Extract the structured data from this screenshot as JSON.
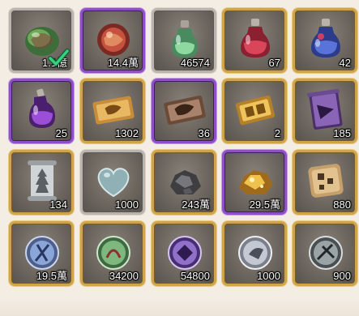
{
  "inventory": {
    "items": [
      {
        "name": "green-orb",
        "qty": "1.1億",
        "frame": "silver",
        "selected": true
      },
      {
        "name": "red-orb",
        "qty": "14.4萬",
        "frame": "purple"
      },
      {
        "name": "green-potion",
        "qty": "46574",
        "frame": "silver"
      },
      {
        "name": "red-potion",
        "qty": "67",
        "frame": "gold"
      },
      {
        "name": "blue-potion",
        "qty": "42",
        "frame": "gold"
      },
      {
        "name": "purple-potion",
        "qty": "25",
        "frame": "purple"
      },
      {
        "name": "gold-ticket",
        "qty": "1302",
        "frame": "gold"
      },
      {
        "name": "bronze-ticket",
        "qty": "36",
        "frame": "purple"
      },
      {
        "name": "gold-coupon",
        "qty": "2",
        "frame": "gold"
      },
      {
        "name": "purple-scroll",
        "qty": "185",
        "frame": "gold"
      },
      {
        "name": "silver-scroll",
        "qty": "134",
        "frame": "gold"
      },
      {
        "name": "silver-heart",
        "qty": "1000",
        "frame": "silver"
      },
      {
        "name": "iron-ore",
        "qty": "243萬",
        "frame": "gold"
      },
      {
        "name": "gold-ore",
        "qty": "29.5萬",
        "frame": "purple"
      },
      {
        "name": "gold-cookie",
        "qty": "880",
        "frame": "gold"
      },
      {
        "name": "blue-medal",
        "qty": "19.5萬",
        "frame": "gold"
      },
      {
        "name": "green-medal",
        "qty": "34200",
        "frame": "gold"
      },
      {
        "name": "purple-medal",
        "qty": "54800",
        "frame": "gold"
      },
      {
        "name": "silver-medal",
        "qty": "1000",
        "frame": "gold"
      },
      {
        "name": "dark-medal",
        "qty": "900",
        "frame": "gold"
      }
    ]
  },
  "colors": {
    "frame_silver": "#b9b4ae",
    "frame_gold": "#d0a44a",
    "frame_purple": "#8e4fc8",
    "background": "#f3ede4",
    "check": "#37d07d"
  }
}
